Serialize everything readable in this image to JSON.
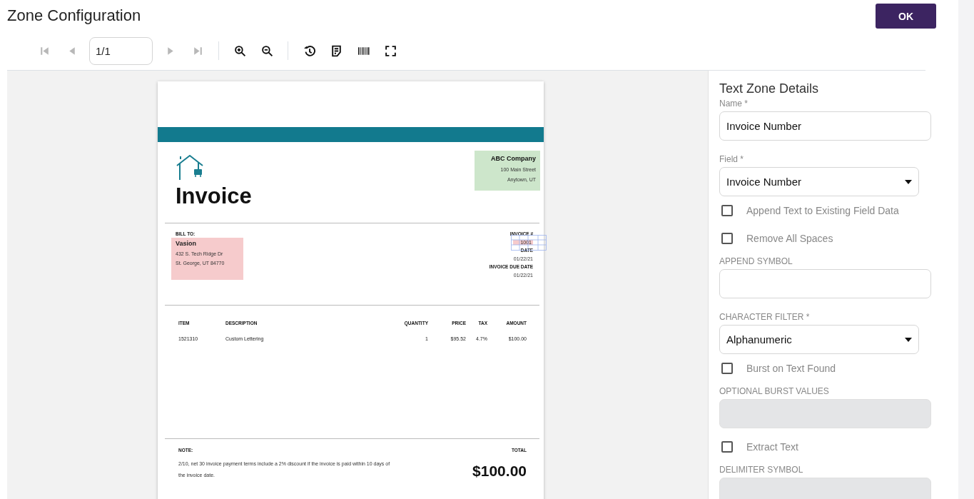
{
  "header": {
    "title": "Zone Configuration",
    "ok_button": "OK"
  },
  "toolbar": [
    {
      "kind": "first",
      "disabled": true
    },
    {
      "kind": "prev",
      "disabled": true
    },
    {
      "kind": "page_field",
      "value": "1/1"
    },
    {
      "kind": "next",
      "disabled": true
    },
    {
      "kind": "last",
      "disabled": true
    },
    {
      "kind": "separator"
    },
    {
      "kind": "zoom_in",
      "disabled": false
    },
    {
      "kind": "zoom_out",
      "disabled": false
    },
    {
      "kind": "separator"
    },
    {
      "kind": "history",
      "disabled": false
    },
    {
      "kind": "note",
      "disabled": false
    },
    {
      "kind": "barcode",
      "disabled": false
    },
    {
      "kind": "fullscreen",
      "disabled": false
    }
  ],
  "document": {
    "title": "Invoice",
    "company": {
      "name": "ABC Company",
      "lines": [
        "100 Main Street",
        "Anytown, UT"
      ]
    },
    "bill_to": {
      "label": "BILL TO:",
      "name": "Vasion",
      "lines": [
        "432 S. Tech Ridge Dr",
        "St. George, UT 84770"
      ]
    },
    "meta": [
      {
        "label": "INVOICE #",
        "value": "1001",
        "selected": true
      },
      {
        "label": "DATE",
        "value": "01/22/21",
        "selected": false
      },
      {
        "label": "INVOICE DUE DATE",
        "value": "01/22/21",
        "selected": false
      }
    ],
    "table": {
      "columns": [
        "ITEM",
        "DESCRIPTION",
        "QUANTITY",
        "PRICE",
        "TAX",
        "AMOUNT"
      ],
      "rows": [
        [
          "1521310",
          "Custom Lettering",
          "1",
          "$95.52",
          "4.7%",
          "$100.00"
        ]
      ]
    },
    "note": {
      "label": "NOTE:",
      "text": "2/10, net 30 invoice payment terms include a 2% discount if the invoice is paid within 10 days of the invoice date."
    },
    "total": {
      "label": "TOTAL",
      "value": "$100.00"
    }
  },
  "panel": {
    "title": "Text Zone Details",
    "items": [
      {
        "kind": "input",
        "label": "Name *",
        "value": "Invoice Number"
      },
      {
        "kind": "select",
        "label": "Field *",
        "value": "Invoice Number"
      },
      {
        "kind": "checkbox",
        "label": "Append Text to Existing Field Data",
        "checked": false
      },
      {
        "kind": "checkbox",
        "label": "Remove All Spaces",
        "checked": false
      },
      {
        "kind": "input",
        "label": "APPEND SYMBOL"
      },
      {
        "kind": "select",
        "label": "CHARACTER FILTER *",
        "value": "Alphanumeric"
      },
      {
        "kind": "checkbox",
        "label": "Burst on Text Found",
        "checked": false
      },
      {
        "kind": "disabled_input",
        "label": "OPTIONAL BURST VALUES"
      },
      {
        "kind": "checkbox",
        "label": "Extract Text",
        "checked": false
      },
      {
        "kind": "disabled_input",
        "label": "DELIMITER SYMBOL"
      }
    ]
  }
}
